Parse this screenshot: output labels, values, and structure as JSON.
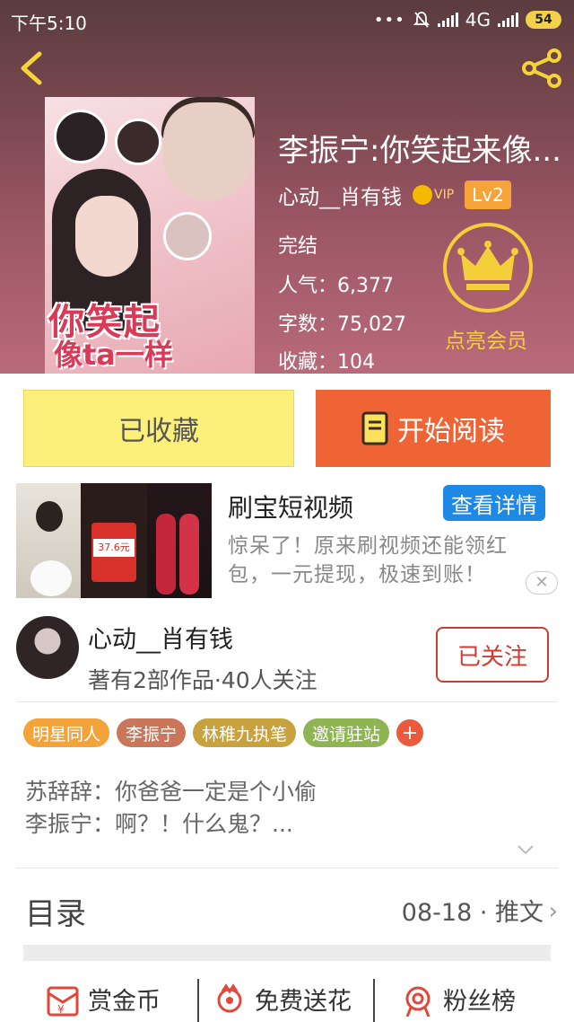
{
  "status_bar": {
    "time": "下午5:10",
    "network": "4G",
    "battery": "54"
  },
  "book": {
    "title": "李振宁:你笑起来像...",
    "author": "心动__肖有钱",
    "vip_label": "VIP",
    "level": "Lv2",
    "status": "完结",
    "popularity": "人气：6,377",
    "word_count": "字数：75,027",
    "favorites": "收藏：104",
    "member_label": "点亮会员",
    "cover_text_line1": "你笑起",
    "cover_text_line2": "像ta一样"
  },
  "actions": {
    "collected_label": "已收藏",
    "read_label": "开始阅读"
  },
  "ad": {
    "title": "刷宝短视频",
    "detail_label": "查看详情",
    "description": "惊呆了！原来刷视频还能领红包，一元提现，极速到账！",
    "amount_text": "37.6元",
    "close_label": "✕"
  },
  "author_block": {
    "name": "心动__肖有钱",
    "meta": "著有2部作品·40人关注",
    "follow_label": "已关注"
  },
  "tags": [
    {
      "label": "明星同人",
      "color": "#f3a33a"
    },
    {
      "label": "李振宁",
      "color": "#c9765a"
    },
    {
      "label": "林稚九执笔",
      "color": "#c7a23d"
    },
    {
      "label": "邀请驻站",
      "color": "#8fb552"
    }
  ],
  "tag_add_label": "+",
  "summary": {
    "line1": "苏辞辞：你爸爸一定是个小偷",
    "line2": "李振宁：啊？！什么鬼？..."
  },
  "toc": {
    "title": "目录",
    "info": "08-18 · 推文",
    "chevron": "›"
  },
  "bottom_bar": {
    "reward_label": "赏金币",
    "flower_label": "免费送花",
    "fans_label": "粉丝榜"
  },
  "colors": {
    "accent_orange": "#ef6434",
    "collect_yellow": "#fcef7a",
    "gold": "#f5cf3a",
    "follow_red": "#cf3b2f",
    "ad_blue": "#1e88e5"
  }
}
